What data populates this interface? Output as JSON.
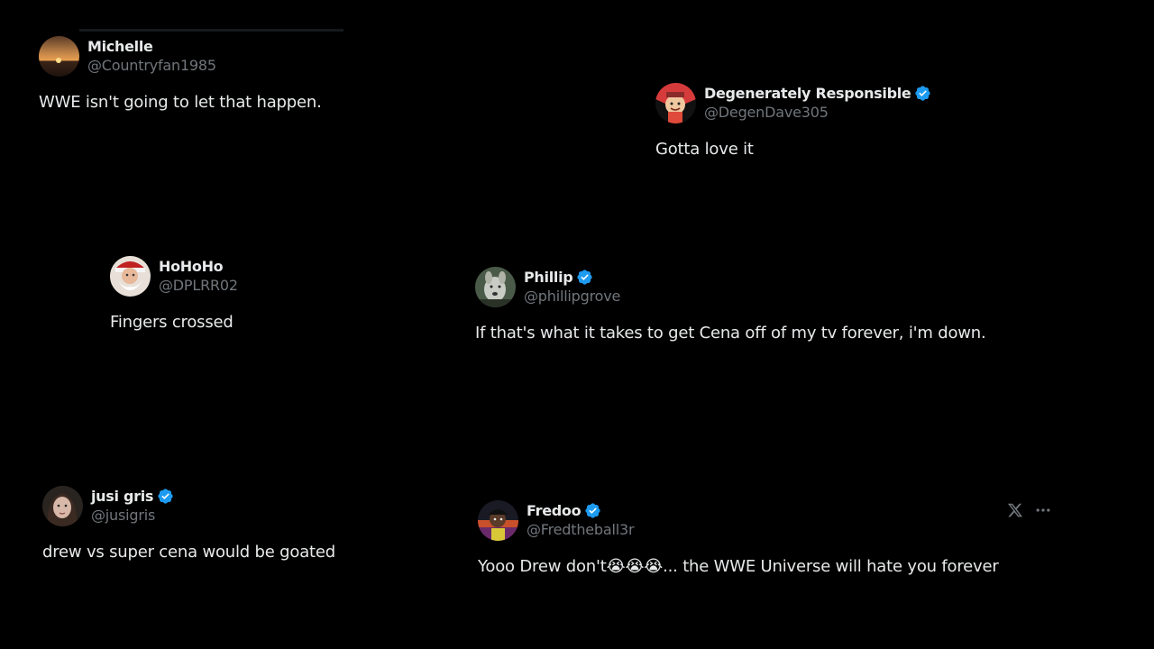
{
  "tweets": [
    {
      "display_name": "Michelle",
      "handle": "@Countryfan1985",
      "text": "WWE isn't going to let that happen.",
      "verified": false
    },
    {
      "display_name": "Degenerately Responsible",
      "handle": "@DegenDave305",
      "text": "Gotta love it",
      "verified": true
    },
    {
      "display_name": "HoHoHo",
      "handle": "@DPLRR02",
      "text": "Fingers crossed",
      "verified": false
    },
    {
      "display_name": "Phillip",
      "handle": "@phillipgrove",
      "text": "If that's what it takes to get Cena off of my tv forever, i'm down.",
      "verified": true
    },
    {
      "display_name": "jusi gris",
      "handle": "@jusigris",
      "text": "drew vs super cena would be goated",
      "verified": true
    },
    {
      "display_name": "Fredoo",
      "handle": "@Fredtheball3r",
      "text_before": "Yooo Drew don't",
      "emojis": "😭😭😭",
      "text_after": "... the WWE Universe will hate you forever",
      "verified": true
    }
  ],
  "icons": {
    "verified": "verified-badge-icon",
    "x_logo": "x-logo-icon",
    "more": "more-options-icon"
  },
  "colors": {
    "background": "#000000",
    "text": "#e7e9ea",
    "muted": "#71767b",
    "verified": "#1d9bf0"
  }
}
